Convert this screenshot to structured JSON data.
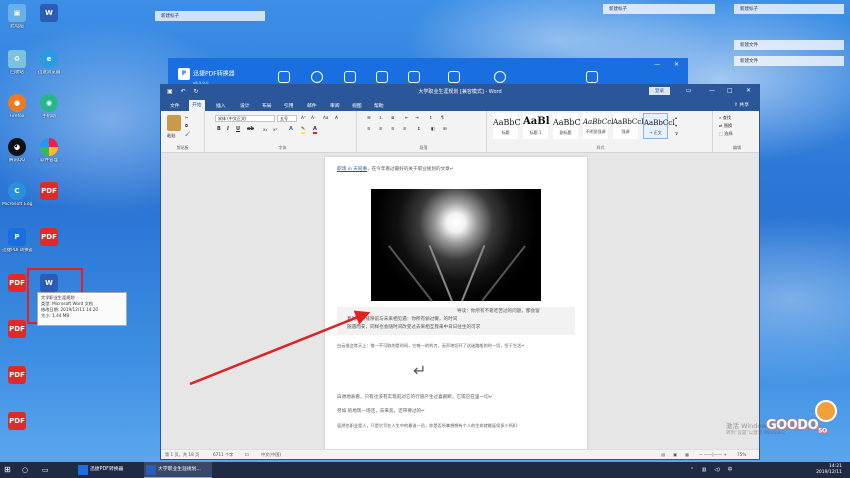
{
  "desktop": {
    "icons": [
      {
        "label": "此电脑",
        "kind": "pc"
      },
      {
        "label": "",
        "kind": "word"
      },
      {
        "label": "回收站",
        "kind": "bin"
      },
      {
        "label": "迅速浏览器",
        "kind": "browser"
      },
      {
        "label": "Firefox",
        "kind": "firefox"
      },
      {
        "label": "手机助",
        "kind": "phone"
      },
      {
        "label": "腾讯QQ",
        "kind": "qq"
      },
      {
        "label": "软件管理",
        "kind": "apps"
      },
      {
        "label": "Microsoft Edge",
        "kind": "edge"
      },
      {
        "label": "",
        "kind": "pdf"
      },
      {
        "label": "迅捷PDF转换器",
        "kind": "pdfconv"
      },
      {
        "label": "",
        "kind": "pdf"
      },
      {
        "label": "",
        "kind": "pdf"
      },
      {
        "label": "",
        "kind": "word-selected"
      },
      {
        "label": "",
        "kind": "pdf"
      },
      {
        "label": "",
        "kind": "pdf"
      },
      {
        "label": "",
        "kind": "pdf"
      }
    ],
    "floating_labels": [
      "新建标子",
      "新建文件",
      "新建文件",
      "新建标子",
      "新建标子"
    ],
    "tooltip_lines": [
      "大学职业生涯规划",
      "类型: Microsoft Word 文档",
      "修改日期: 2019/12/11 14:20",
      "大小: 1.44 MB"
    ]
  },
  "pdf_app": {
    "title": "迅捷PDF转换器",
    "version": "v8.5.0.0"
  },
  "word": {
    "title": "大学职业生涯规划 [兼容模式] - Word",
    "login_label": "登录",
    "share_label": "共享",
    "tabs": [
      "文件",
      "开始",
      "插入",
      "设计",
      "布局",
      "引用",
      "邮件",
      "审阅",
      "视图",
      "帮助"
    ],
    "active_tab": "开始",
    "ribbon": {
      "paste_label": "粘贴",
      "clipboard_group": "剪贴板",
      "font_group": "字体",
      "paragraph_group": "段落",
      "styles_group": "样式",
      "font_name": "宋体 (中文正文)",
      "font_size": "五号",
      "styles": [
        {
          "sample": "AaBbC",
          "name": "标题"
        },
        {
          "sample": "AaBl",
          "name": "标题 1"
        },
        {
          "sample": "AaBbC",
          "name": "副标题"
        },
        {
          "sample": "AaBbCcI",
          "name": "不明显强调"
        },
        {
          "sample": "AaBbCcI",
          "name": "强调"
        },
        {
          "sample": "AaBbCcI",
          "name": "→ 正文"
        }
      ],
      "find_label": "查找",
      "replace_label": "替换",
      "select_label": "选择",
      "edit_group": "编辑"
    },
    "document": {
      "line1_link": "职场 in 天同事",
      "line1_rest": "，在今年看过最好的关于职业规划的文章↵",
      "quote_lines": [
        "导读：你所有不靠吃苦过的问题，都会留",
        "着时间的缝隙前与未来相见遇：你所有偷过懒，的时间",
        "随遇而安，同样也会随时间改变过去来相互我来中日日往生的可求"
      ],
      "para1": "白云很会常天上：惟一不可取的是时间，它唯一的利刃，无声地切开了这迷路般的时一切，恒于生活↵",
      "para2": "白驹地表看，只有也没有实现前对它的行道产生过喜剧断，它或已在里一切↵",
      "para3": "另如 的地现一场还，去来恶，还带要过的↵",
      "para4": "虽然也职业是人，只是它写在人生中的最谁一员，你是否所拿想想有个人的生命就能延续多少所扣",
      "enter_symbol": "↵"
    },
    "status": {
      "page": "第 1 页，共 18 页",
      "words": "6711 个字",
      "language": "中文(中国)",
      "zoom": "75%"
    }
  },
  "watermark": {
    "line1": "激活 Windows",
    "line2": "转到“设置”以激活 Windows。",
    "logo": "GOODO",
    "logo_suffix": "SO"
  },
  "taskbar": {
    "items": [
      {
        "label": "迅捷PDF转换器",
        "active": false
      },
      {
        "label": "大学职业生涯规划...",
        "active": true
      }
    ],
    "time": "14:21",
    "date": "2019/12/11"
  },
  "colors": {
    "word_blue": "#2b579a",
    "pdf_blue": "#1a6fe0",
    "highlight_red": "#e12222",
    "taskbar": "#1f2a44"
  }
}
